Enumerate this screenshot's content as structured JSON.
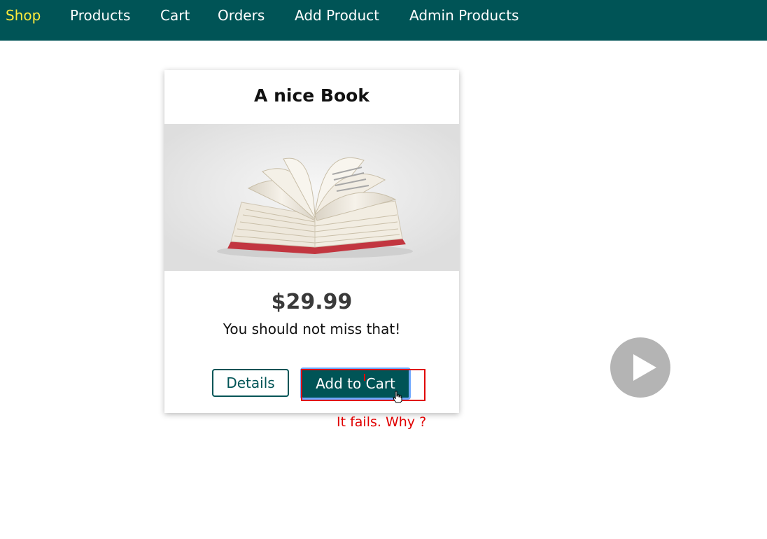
{
  "nav": {
    "items": [
      {
        "label": "Shop",
        "active": true
      },
      {
        "label": "Products",
        "active": false
      },
      {
        "label": "Cart",
        "active": false
      },
      {
        "label": "Orders",
        "active": false
      },
      {
        "label": "Add Product",
        "active": false
      },
      {
        "label": "Admin Products",
        "active": false
      }
    ]
  },
  "product": {
    "title": "A nice Book",
    "image": "open-book-image",
    "price": "$29.99",
    "description": "You should not miss that!",
    "details_label": "Details",
    "add_to_cart_label": "Add to Cart"
  },
  "overlay": {
    "annotation": "It fails. Why ?",
    "play_icon": "play-icon"
  },
  "colors": {
    "nav_bg": "#005456",
    "nav_active": "#ffeb3b",
    "primary": "#005456",
    "annotation": "#e00000",
    "play_bg": "#b4b4b4"
  }
}
